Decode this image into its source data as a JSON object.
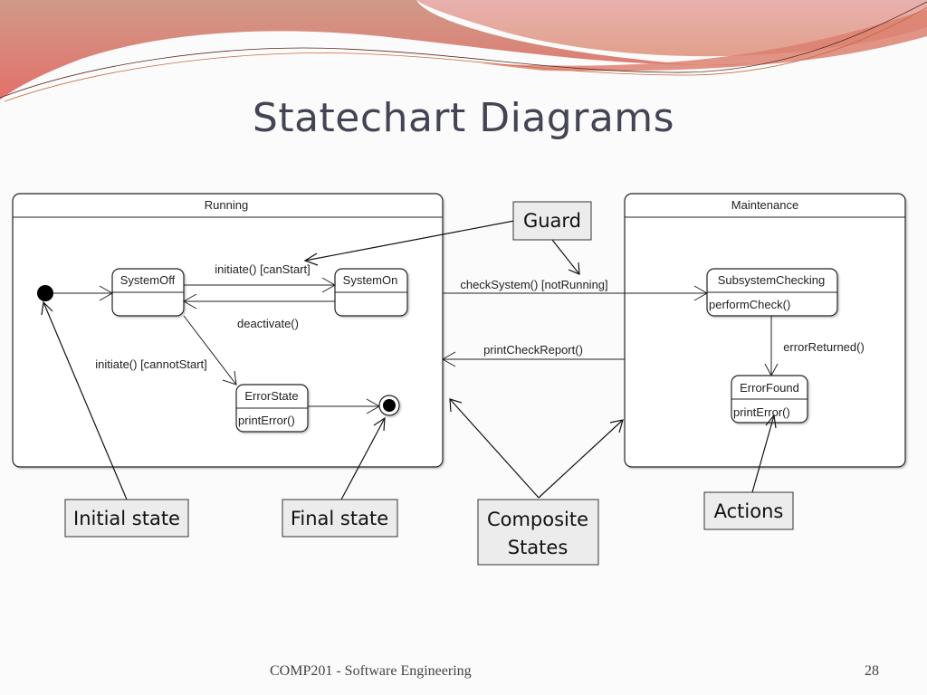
{
  "slide": {
    "title": "Statechart Diagrams",
    "footer": "COMP201 - Software Engineering",
    "page_number": "28",
    "colors": {
      "banner_light": "#e9b3a9",
      "banner_mid": "#d7907f",
      "banner_dark": "#e07266",
      "title_color": "#434454",
      "callout_fill": "#ececec"
    }
  },
  "diagram": {
    "composite_states": {
      "running": {
        "name": "Running"
      },
      "maintenance": {
        "name": "Maintenance"
      }
    },
    "states": {
      "system_off": {
        "name": "SystemOff",
        "action": ""
      },
      "system_on": {
        "name": "SystemOn",
        "action": ""
      },
      "error_state": {
        "name": "ErrorState",
        "action": "printError()"
      },
      "subsystem_checking": {
        "name": "SubsystemChecking",
        "action": "performCheck()"
      },
      "error_found": {
        "name": "ErrorFound",
        "action": "printError()"
      }
    },
    "transitions": {
      "initiate_can_start": "initiate() [canStart]",
      "deactivate": "deactivate()",
      "initiate_cannot_start": "initiate() [cannotStart]",
      "check_system": "checkSystem() [notRunning]",
      "print_check_report": "printCheckReport()",
      "error_returned": "errorReturned()"
    },
    "callouts": {
      "guard": "Guard",
      "initial_state": "Initial state",
      "final_state": "Final state",
      "composite_line1": "Composite",
      "composite_line2": "States",
      "actions": "Actions"
    }
  }
}
